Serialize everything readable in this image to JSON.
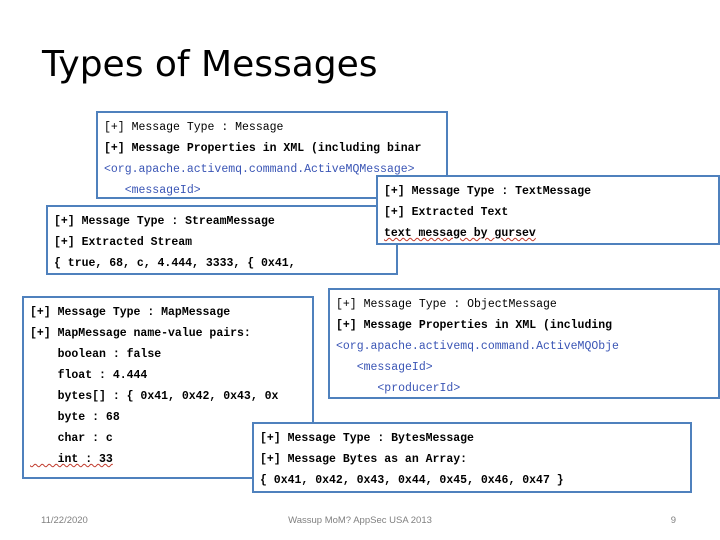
{
  "slide": {
    "title": "Types of Messages",
    "accent_color": "#4F81BD",
    "xml_color": "#3A55B5"
  },
  "boxes": {
    "message": {
      "name": "Message",
      "lines": [
        "[+] Message Type : Message",
        "[+] Message Properties in XML (including binar",
        "<org.apache.activemq.command.ActiveMQMessage>",
        "   <messageId>"
      ]
    },
    "text_message": {
      "name": "TextMessage",
      "lines": [
        "[+] Message Type : TextMessage",
        "[+] Extracted Text",
        "text message by gursev"
      ]
    },
    "stream_message": {
      "name": "StreamMessage",
      "lines": [
        "[+] Message Type : StreamMessage",
        "[+] Extracted Stream",
        "{ true, 68, c, 4.444, 3333, { 0x41,"
      ]
    },
    "map_message": {
      "name": "MapMessage",
      "lines": [
        "[+] Message Type : MapMessage",
        "[+] MapMessage name-value pairs:",
        "    boolean : false",
        "    float : 4.444",
        "    bytes[] : { 0x41, 0x42, 0x43, 0x",
        "    byte : 68",
        "    char : c",
        "    int : 33"
      ]
    },
    "object_message": {
      "name": "ObjectMessage",
      "lines": [
        "[+] Message Type : ObjectMessage",
        "[+] Message Properties in XML (including",
        "<org.apache.activemq.command.ActiveMQObje",
        "   <messageId>",
        "      <producerId>"
      ]
    },
    "bytes_message": {
      "name": "BytesMessage",
      "lines": [
        "[+] Message Type : BytesMessage",
        "[+] Message Bytes as an Array:",
        "{ 0x41, 0x42, 0x43, 0x44, 0x45, 0x46, 0x47 }"
      ]
    }
  },
  "footer": {
    "date": "11/22/2020",
    "note": "Wassup MoM? AppSec USA 2013",
    "page": "9"
  }
}
